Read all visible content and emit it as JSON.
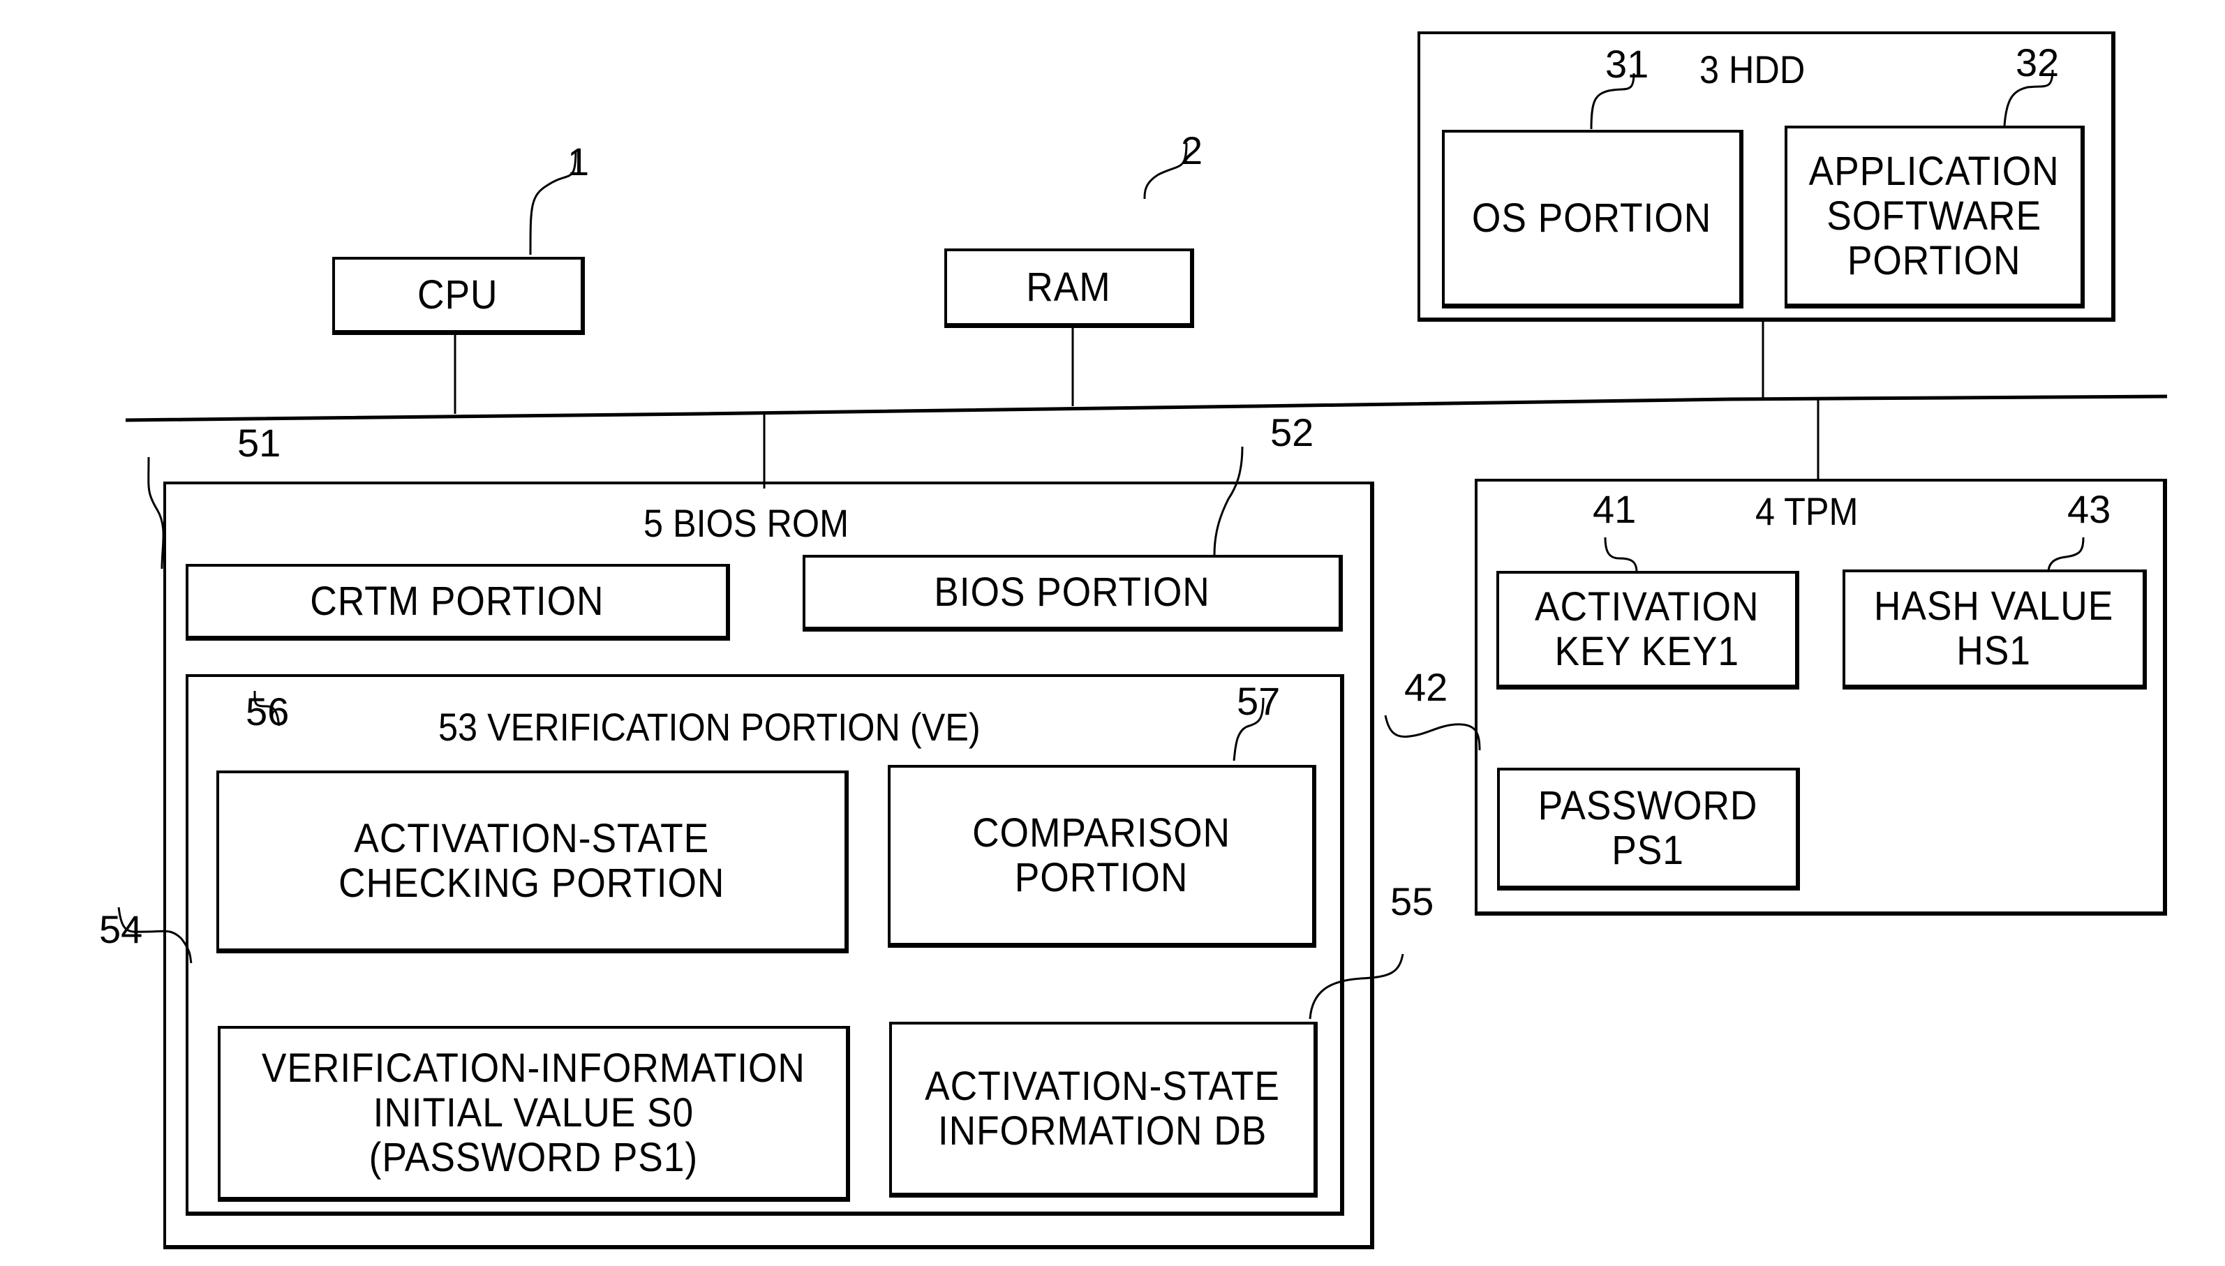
{
  "diagram": {
    "components": {
      "cpu": {
        "ref": "1",
        "label": "CPU"
      },
      "ram": {
        "ref": "2",
        "label": "RAM"
      },
      "hdd": {
        "title": "3 HDD",
        "os_portion": {
          "ref": "31",
          "label": "OS PORTION"
        },
        "app_portion": {
          "ref": "32",
          "label": "APPLICATION\nSOFTWARE\nPORTION"
        }
      },
      "tpm": {
        "title": "4 TPM",
        "activation_key": {
          "ref": "41",
          "label": "ACTIVATION\nKEY KEY1"
        },
        "password": {
          "ref": "42",
          "label": "PASSWORD\nPS1"
        },
        "hash_value": {
          "ref": "43",
          "label": "HASH VALUE\nHS1"
        }
      },
      "bios_rom": {
        "title": "5 BIOS ROM",
        "crtm_portion": {
          "ref": "51",
          "label": "CRTM PORTION"
        },
        "bios_portion": {
          "ref": "52",
          "label": "BIOS PORTION"
        },
        "verification_portion": {
          "title": "53 VERIFICATION PORTION (VE)",
          "activation_state_checking": {
            "ref": "56",
            "label": "ACTIVATION-STATE\nCHECKING PORTION"
          },
          "comparison": {
            "ref": "57",
            "label": "COMPARISON\nPORTION"
          },
          "verification_info_initial": {
            "ref": "54",
            "label": "VERIFICATION-INFORMATION\nINITIAL VALUE S0\n(PASSWORD PS1)"
          },
          "activation_state_db": {
            "ref": "55",
            "label": "ACTIVATION-STATE\nINFORMATION DB"
          }
        }
      }
    }
  }
}
